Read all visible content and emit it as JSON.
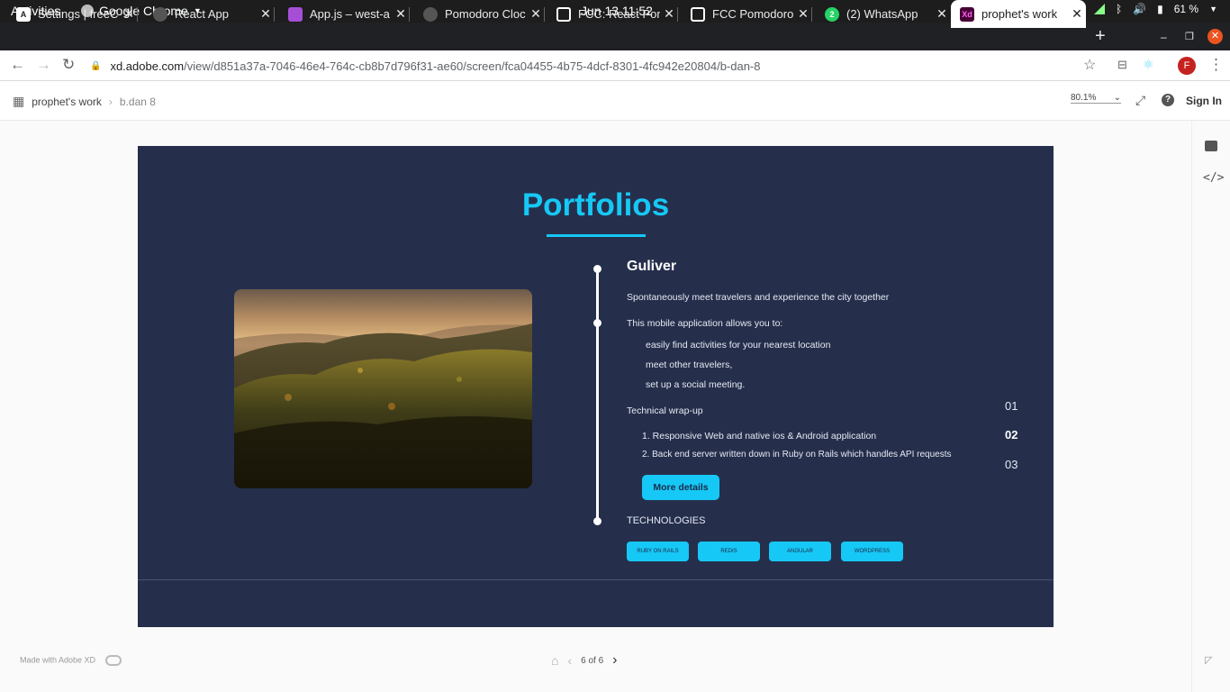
{
  "system": {
    "activities": "Activities",
    "app": "Google Chrome",
    "clock": "Jun 13  11:52",
    "battery": "61 %"
  },
  "tabs": [
    {
      "title": "Settings | freeC",
      "icon": "A"
    },
    {
      "title": "React App",
      "icon": ""
    },
    {
      "title": "App.js – west-a",
      "icon": ""
    },
    {
      "title": "Pomodoro Cloc",
      "icon": ""
    },
    {
      "title": "FCC: React Pom",
      "icon": ""
    },
    {
      "title": "FCC Pomodoro",
      "icon": ""
    },
    {
      "title": "(2) WhatsApp",
      "icon": "2"
    },
    {
      "title": "prophet's work",
      "icon": "Xd"
    }
  ],
  "address": {
    "host": "xd.adobe.com",
    "path": "/view/d851a37a-7046-46e4-764c-cb8b7d796f31-ae60/screen/fca04455-4b75-4dcf-8301-4fc942e20804/b-dan-8",
    "profile": "F"
  },
  "xd": {
    "project": "prophet's work",
    "screen": "b.dan  8",
    "zoom": "80.1%",
    "sign_in": "Sign In",
    "made_with": "Made with Adobe XD",
    "page": "6 of 6"
  },
  "portfolio": {
    "heading": "Portfolios",
    "name": "Guliver",
    "tagline": "Spontaneously meet travelers and experience the city together",
    "intro": "This mobile application allows you to:",
    "features": [
      "easily find activities for your nearest location",
      "meet other travelers,",
      "set up a social meeting."
    ],
    "wrap_title": "Technical wrap-up",
    "wrap_items": [
      "1. Responsive Web and native ios & Android application",
      "2. Back end server written down in Ruby on Rails which handles API requests"
    ],
    "more_btn": "More details",
    "tech_title": "TECHNOLOGIES",
    "tags": [
      "RUBY ON RAILS",
      "REDIS",
      "ANGULAR",
      "WORDPRESS"
    ],
    "numbers": [
      "01",
      "02",
      "03"
    ]
  }
}
